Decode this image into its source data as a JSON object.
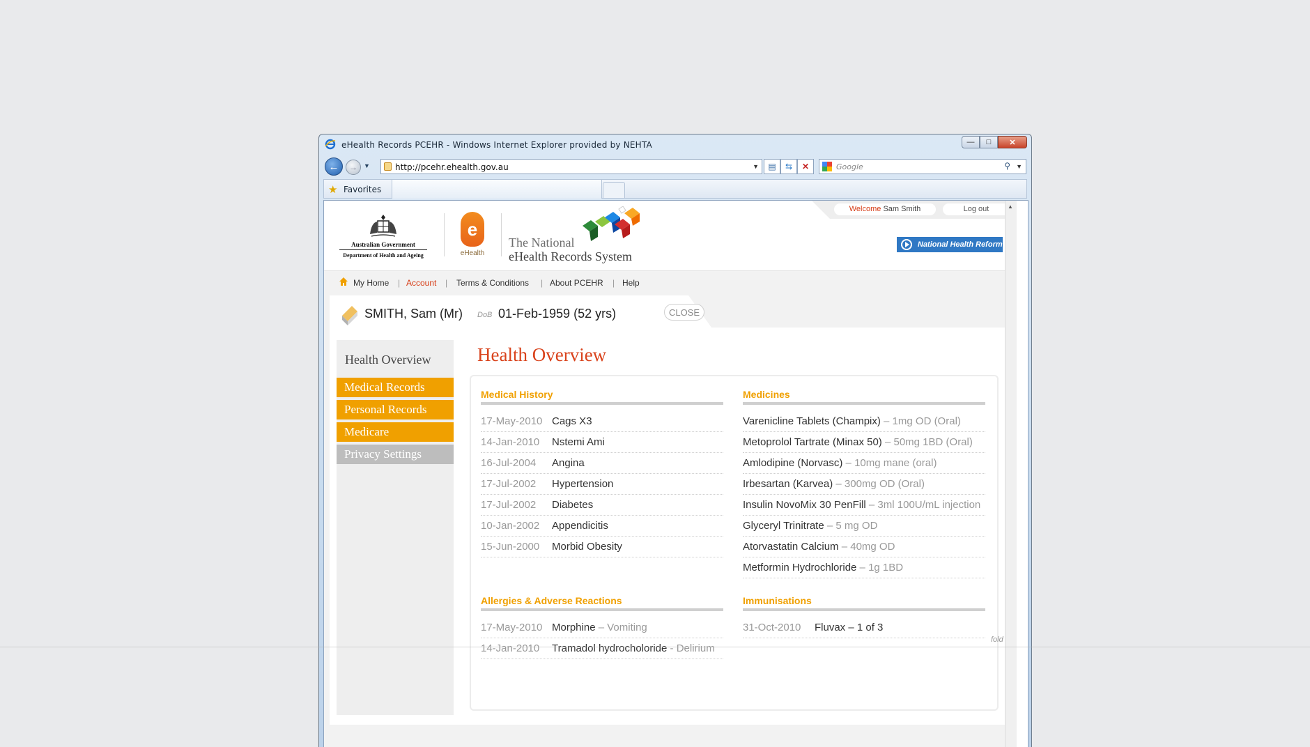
{
  "browser": {
    "title": "eHealth Records PCEHR - Windows Internet Explorer provided by NEHTA",
    "address": "http://pcehr.ehealth.gov.au",
    "search_placeholder": "Google",
    "favorites_label": "Favorites"
  },
  "site": {
    "govt_line1": "Australian Government",
    "govt_line2": "Department of Health and Ageing",
    "ehealth_label": "eHealth",
    "national_line1": "The National",
    "national_line2": "eHealth Records System",
    "welcome_word": "Welcome",
    "welcome_user": "Sam Smith",
    "logout": "Log out",
    "reform_button": "National Health Reform"
  },
  "nav": {
    "items": [
      "My Home",
      "Account",
      "Terms & Conditions",
      "About PCEHR",
      "Help"
    ],
    "active": "Account",
    "separator": "|"
  },
  "patient": {
    "name": "SMITH, Sam (Mr)",
    "dob_label": "DoB",
    "dob": "01-Feb-1959 (52 yrs)",
    "close": "CLOSE"
  },
  "sidebar": {
    "title": "Health Overview",
    "items": [
      "Medical Records",
      "Personal Records",
      "Medicare",
      "Privacy Settings"
    ]
  },
  "main": {
    "title": "Health Overview",
    "medical_history": {
      "title": "Medical History",
      "rows": [
        {
          "date": "17-May-2010",
          "condition": "Cags X3"
        },
        {
          "date": "14-Jan-2010",
          "condition": "Nstemi Ami"
        },
        {
          "date": "16-Jul-2004",
          "condition": "Angina"
        },
        {
          "date": "17-Jul-2002",
          "condition": "Hypertension"
        },
        {
          "date": "17-Jul-2002",
          "condition": "Diabetes"
        },
        {
          "date": "10-Jan-2002",
          "condition": "Appendicitis"
        },
        {
          "date": "15-Jun-2000",
          "condition": "Morbid Obesity"
        }
      ]
    },
    "medicines": {
      "title": "Medicines",
      "rows": [
        {
          "name": "Varenicline Tablets (Champix)",
          "detail": " – 1mg OD (Oral)"
        },
        {
          "name": "Metoprolol Tartrate (Minax 50)",
          "detail": " – 50mg 1BD (Oral)"
        },
        {
          "name": "Amlodipine (Norvasc)",
          "detail": " – 10mg mane (oral)"
        },
        {
          "name": "Irbesartan (Karvea)",
          "detail": " – 300mg OD (Oral)"
        },
        {
          "name": "Insulin NovoMix 30 PenFill",
          "detail": " – 3ml 100U/mL injection"
        },
        {
          "name": "Glyceryl Trinitrate",
          "detail": " – 5 mg OD"
        },
        {
          "name": "Atorvastatin Calcium",
          "detail": " – 40mg OD"
        },
        {
          "name": "Metformin Hydrochloride",
          "detail": " – 1g 1BD"
        }
      ]
    },
    "allergies": {
      "title": "Allergies & Adverse Reactions",
      "rows": [
        {
          "date": "17-May-2010",
          "name": "Morphine",
          "detail": " – Vomiting"
        },
        {
          "date": "14-Jan-2010",
          "name": "Tramadol hydrocholoride",
          "detail": " - Delirium"
        }
      ]
    },
    "immunisations": {
      "title": "Immunisations",
      "rows": [
        {
          "date": "31-Oct-2010",
          "name": "Fluvax – 1 of 3"
        }
      ]
    },
    "fold_label": "fold"
  },
  "colors": {
    "accent_orange": "#f0a000",
    "title_red": "#d9431c",
    "reform_blue": "#2f78c4"
  }
}
